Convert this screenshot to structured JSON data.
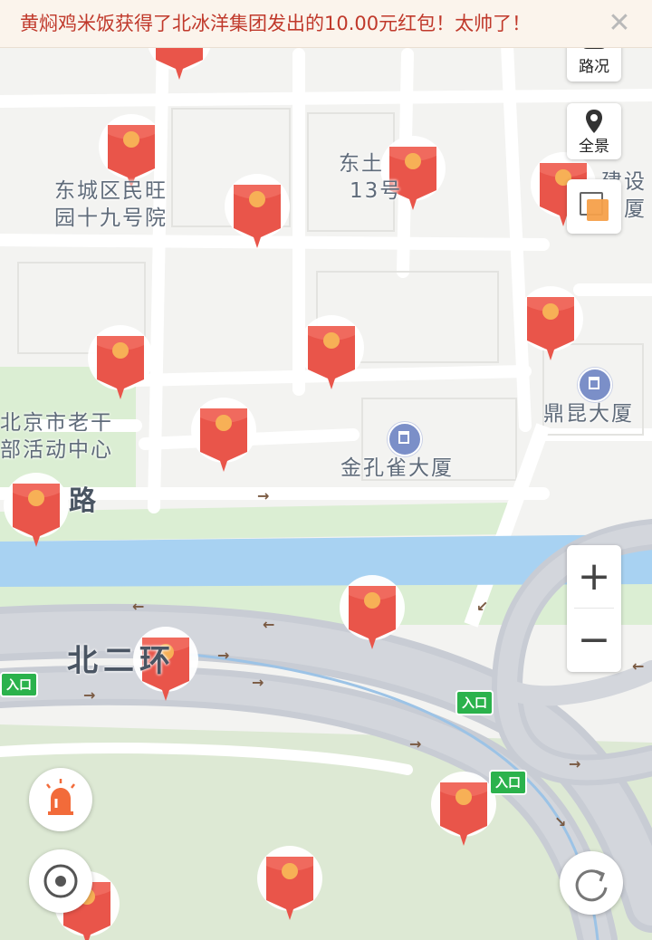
{
  "notice": {
    "text": "黄焖鸡米饭获得了北冰洋集团发出的10.00元红包！太帅了！",
    "close": "✕"
  },
  "controls": {
    "traffic_label": "路况",
    "panorama_label": "全景",
    "zoom_in": "+",
    "zoom_out": "−"
  },
  "map": {
    "labels": {
      "dongcheng_line1": "东城区民旺",
      "dongcheng_line2": "园十九号院",
      "dongtu_line1": "东土",
      "dongtu_line2": "13号",
      "jianshe_line1": "建设",
      "jianshe_line2": "大厦",
      "laogan_line1": "北京市老干",
      "laogan_line2": "部活动中心",
      "dingkun": "鼎昆大厦",
      "jinkongque": "金孔雀大厦",
      "road_lu": "路",
      "beierhuan": "北二环"
    },
    "entrance_badges": [
      "入口",
      "入口",
      "入口"
    ],
    "red_packet_count": 15,
    "colors": {
      "water": "#a8d2f2",
      "green": "#dbeed3",
      "road": "#ffffff",
      "highway": "#c8ccd4",
      "red_packet": "#e9554a",
      "coin": "#f7b056",
      "notice_text": "#c0392b"
    }
  }
}
